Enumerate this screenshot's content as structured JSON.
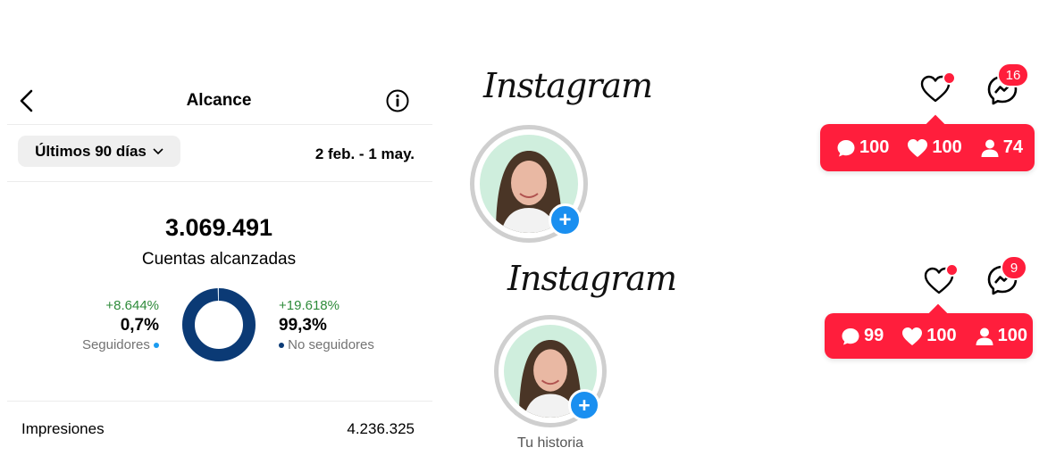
{
  "insights": {
    "header_title": "Alcance",
    "period_label": "Últimos 90 días",
    "date_range": "2 feb. - 1 may.",
    "total_value": "3.069.491",
    "total_label": "Cuentas alcanzadas",
    "followers": {
      "change": "+8.644%",
      "percent": "0,7%",
      "label": "Seguidores",
      "dot_color": "#1a9bf0"
    },
    "non_followers": {
      "change": "+19.618%",
      "percent": "99,3%",
      "label": "No seguidores",
      "dot_color": "#0b3a75"
    },
    "impressions_label": "Impresiones",
    "impressions_value": "4.236.325",
    "donut_colors": {
      "followers": "#d9e7f5",
      "non_followers": "#0b3a75"
    },
    "donut_share": {
      "followers": 0.007,
      "non_followers": 0.993
    }
  },
  "feed_top": {
    "logo": "Instagram",
    "messages_badge": "16",
    "notification": {
      "comments": "100",
      "likes": "100",
      "follows": "74"
    }
  },
  "feed_bottom": {
    "logo": "Instagram",
    "messages_badge": "9",
    "notification": {
      "comments": "99",
      "likes": "100",
      "follows": "100"
    },
    "story_label": "Tu historia"
  },
  "colors": {
    "accent_red": "#ff1e3c",
    "accent_blue": "#1a8ff0",
    "positive_green": "#2e8b3a"
  }
}
